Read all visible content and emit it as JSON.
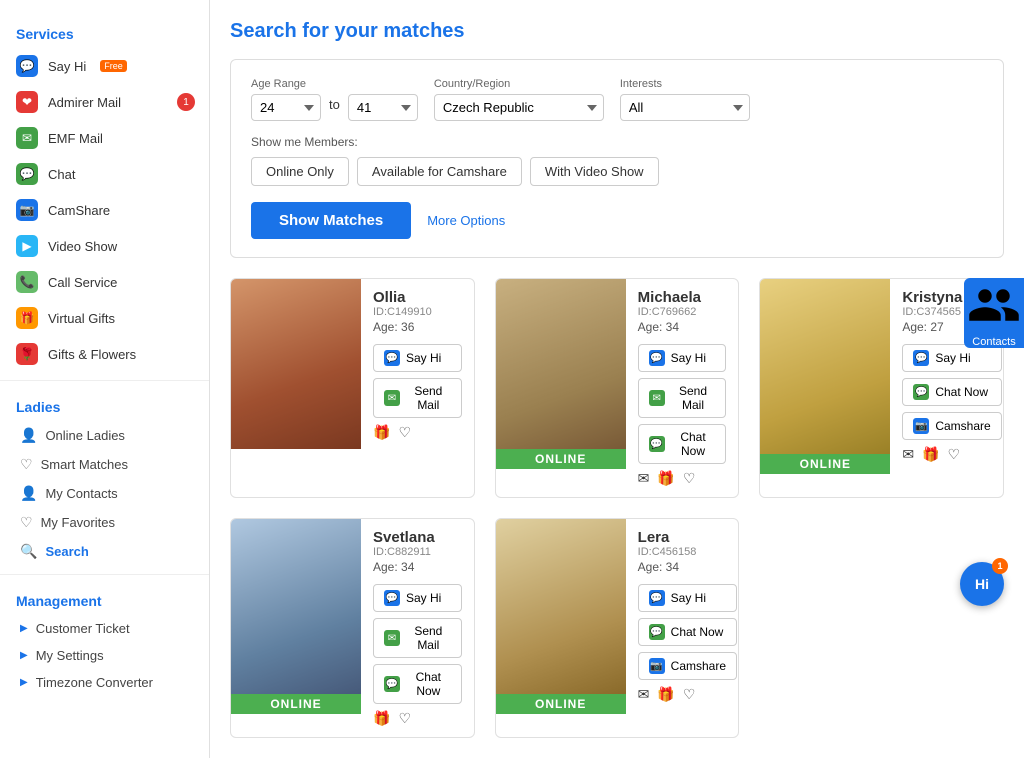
{
  "sidebar": {
    "services_title": "Services",
    "ladies_title": "Ladies",
    "management_title": "Management",
    "services_items": [
      {
        "label": "Say Hi",
        "id": "say-hi",
        "badge_free": true,
        "color": "#1a73e8",
        "icon": "💬"
      },
      {
        "label": "Admirer Mail",
        "id": "admirer-mail",
        "badge_num": 1,
        "color": "#e53935",
        "icon": "❤"
      },
      {
        "label": "EMF Mail",
        "id": "emf-mail",
        "color": "#43a047",
        "icon": "✉"
      },
      {
        "label": "Chat",
        "id": "chat",
        "color": "#43a047",
        "icon": "💬"
      },
      {
        "label": "CamShare",
        "id": "camshare",
        "color": "#1a73e8",
        "icon": "📷"
      },
      {
        "label": "Video Show",
        "id": "video-show",
        "color": "#29b6f6",
        "icon": "▶"
      },
      {
        "label": "Call Service",
        "id": "call-service",
        "color": "#66bb6a",
        "icon": "📞"
      },
      {
        "label": "Virtual Gifts",
        "id": "virtual-gifts",
        "color": "#ff9800",
        "icon": "🎁"
      },
      {
        "label": "Gifts & Flowers",
        "id": "gifts-flowers",
        "color": "#e53935",
        "icon": "🌹"
      }
    ],
    "ladies_items": [
      {
        "label": "Online Ladies",
        "id": "online-ladies",
        "icon": "👤"
      },
      {
        "label": "Smart Matches",
        "id": "smart-matches",
        "icon": "♡"
      },
      {
        "label": "My Contacts",
        "id": "my-contacts",
        "icon": "👤"
      },
      {
        "label": "My Favorites",
        "id": "my-favorites",
        "icon": "♡"
      },
      {
        "label": "Search",
        "id": "search",
        "icon": "🔍",
        "active": true
      }
    ],
    "management_items": [
      {
        "label": "Customer Ticket",
        "id": "customer-ticket"
      },
      {
        "label": "My Settings",
        "id": "my-settings"
      },
      {
        "label": "Timezone Converter",
        "id": "timezone-converter"
      }
    ]
  },
  "main": {
    "title": "Search for your matches",
    "search": {
      "age_range_label": "Age Range",
      "age_from": "24",
      "age_to": "41",
      "to_text": "to",
      "country_label": "Country/Region",
      "country_value": "Czech Republic",
      "interests_label": "Interests",
      "interests_value": "All",
      "show_me_label": "Show me Members:",
      "toggles": [
        "Online Only",
        "Available for Camshare",
        "With Video Show"
      ],
      "show_matches_btn": "Show Matches",
      "more_options": "More Options"
    },
    "profiles": [
      {
        "name": "Ollia",
        "id": "ID:C149910",
        "age": "Age: 36",
        "online": false,
        "photo_class": "p1",
        "buttons": [
          "Say Hi",
          "Send Mail"
        ],
        "icons": [
          "gift",
          "heart"
        ]
      },
      {
        "name": "Michaela",
        "id": "ID:C769662",
        "age": "Age: 34",
        "online": true,
        "photo_class": "p2",
        "buttons": [
          "Say Hi",
          "Send Mail",
          "Chat Now"
        ],
        "icons": [
          "mail",
          "gift",
          "heart"
        ]
      },
      {
        "name": "Kristyna",
        "id": "ID:C374565",
        "age": "Age: 27",
        "online": true,
        "photo_class": "p3",
        "buttons": [
          "Say Hi",
          "Chat Now",
          "Camshare"
        ],
        "icons": [
          "mail",
          "gift",
          "heart"
        ]
      },
      {
        "name": "Svetlana",
        "id": "ID:C882911",
        "age": "Age: 34",
        "online": true,
        "photo_class": "p4",
        "buttons": [
          "Say Hi",
          "Send Mail",
          "Chat Now"
        ],
        "icons": [
          "gift",
          "heart"
        ]
      },
      {
        "name": "Lera",
        "id": "ID:C456158",
        "age": "Age: 34",
        "online": true,
        "photo_class": "p5",
        "buttons": [
          "Say Hi",
          "Chat Now",
          "Camshare"
        ],
        "icons": [
          "mail",
          "gift",
          "heart"
        ]
      }
    ]
  },
  "contacts_btn": "Contacts",
  "hi_bubble": "Hi",
  "hi_badge": "1",
  "online_text": "ONLINE"
}
